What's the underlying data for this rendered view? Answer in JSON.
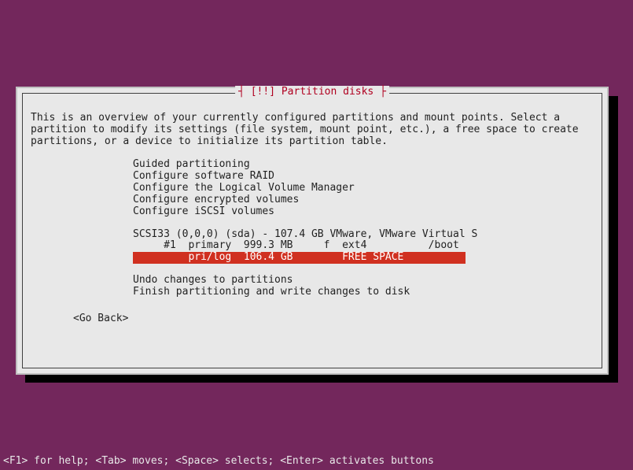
{
  "title": "[!!] Partition disks",
  "description": "This is an overview of your currently configured partitions and mount points. Select a\npartition to modify its settings (file system, mount point, etc.), a free space to create\npartitions, or a device to initialize its partition table.",
  "menu": {
    "config_items": [
      "Guided partitioning",
      "Configure software RAID",
      "Configure the Logical Volume Manager",
      "Configure encrypted volumes",
      "Configure iSCSI volumes"
    ],
    "disk_header": "SCSI33 (0,0,0) (sda) - 107.4 GB VMware, VMware Virtual S",
    "partition1": "     #1  primary  999.3 MB     f  ext4          /boot",
    "partition2_selected": "         pri/log  106.4 GB        FREE SPACE          ",
    "action_items": [
      "Undo changes to partitions",
      "Finish partitioning and write changes to disk"
    ]
  },
  "go_back": "<Go Back>",
  "footer": "<F1> for help; <Tab> moves; <Space> selects; <Enter> activates buttons"
}
